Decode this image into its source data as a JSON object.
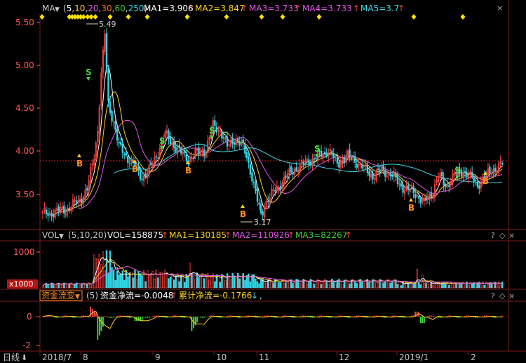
{
  "colors": {
    "up": "#ff4444",
    "down": "#33d6e6",
    "ma1": "#ffffff",
    "ma2": "#ffd21f",
    "ma3": "#e25ae6",
    "ma4": "#3fcf3f",
    "ma5": "#3fd9ea",
    "grid": "#7a1b1b",
    "axis_text": "#ff5a5a",
    "label_text": "#c8c8c8",
    "diamond": "#ffe000",
    "buy": "#ff8c1a",
    "sell": "#3fdf3f",
    "ref_line": "#c82828"
  },
  "main_panel": {
    "indicator": "MA",
    "param_open": "(",
    "params": [
      "5",
      "10",
      "20",
      "30",
      "60",
      "250"
    ],
    "param_close": ")",
    "values": [
      {
        "label": "MA1=3.906",
        "color_key": "ma1"
      },
      {
        "label": "MA2=3.847",
        "color_key": "ma2"
      },
      {
        "label": "MA3=3.733",
        "color_key": "ma3"
      },
      {
        "label": "MA4=3.733",
        "color_key": "ma4"
      },
      {
        "label": "MA5=3.7",
        "color_key": "ma5"
      }
    ],
    "arrow": "↑",
    "y_ticks": [
      "5.50",
      "5.00",
      "4.50",
      "4.00",
      "3.50"
    ],
    "high_label": "5.49",
    "low_label": "3.17",
    "buy_label": "B",
    "sell_label": "S"
  },
  "volume_panel": {
    "indicator": "VOL",
    "params": "(5,10,20)",
    "values": [
      {
        "label": "VOL=158875",
        "color_key": "ma1"
      },
      {
        "label": "MA1=130185",
        "color_key": "ma2"
      },
      {
        "label": "MA2=110926",
        "color_key": "ma3"
      },
      {
        "label": "MA3=82267",
        "color_key": "ma4"
      }
    ],
    "arrow": "↑",
    "y_tick": "1000",
    "unit_badge": "x1000"
  },
  "flow_panel": {
    "indicator": "资金流变",
    "params": "(5)",
    "values": [
      {
        "label": "资金净流=-0.0048",
        "arrow": "↑"
      },
      {
        "label": "累计净流=-0.1766",
        "arrow": "↓"
      }
    ],
    "trailing": ",",
    "y_ticks": [
      "0",
      "-2"
    ]
  },
  "x_axis": {
    "period_label": "日线",
    "labels": [
      "2018/7",
      "8",
      "9",
      "10",
      "11",
      "12",
      "2019/1",
      "2"
    ]
  },
  "corner_buttons": [
    "?",
    "◇",
    "×"
  ],
  "chart_data": {
    "type": "candlestick",
    "title": "",
    "y_ticks": [
      5.5,
      5.0,
      4.5,
      4.0,
      3.5
    ],
    "x_tick_labels": [
      "2018/7",
      "8",
      "9",
      "10",
      "11",
      "12",
      "2019/1",
      "2"
    ],
    "annotations": [
      {
        "text": "5.49",
        "value": 5.49
      },
      {
        "text": "3.17",
        "value": 3.17
      }
    ],
    "series": [
      {
        "name": "MA1",
        "last": 3.906
      },
      {
        "name": "MA2",
        "last": 3.847
      },
      {
        "name": "MA3",
        "last": 3.733
      },
      {
        "name": "MA4",
        "last": 3.733
      },
      {
        "name": "MA5",
        "last": 3.7
      },
      {
        "name": "VOL",
        "last": 158875
      },
      {
        "name": "资金净流",
        "last": -0.0048
      },
      {
        "name": "累计净流",
        "last": -0.1766
      }
    ]
  }
}
